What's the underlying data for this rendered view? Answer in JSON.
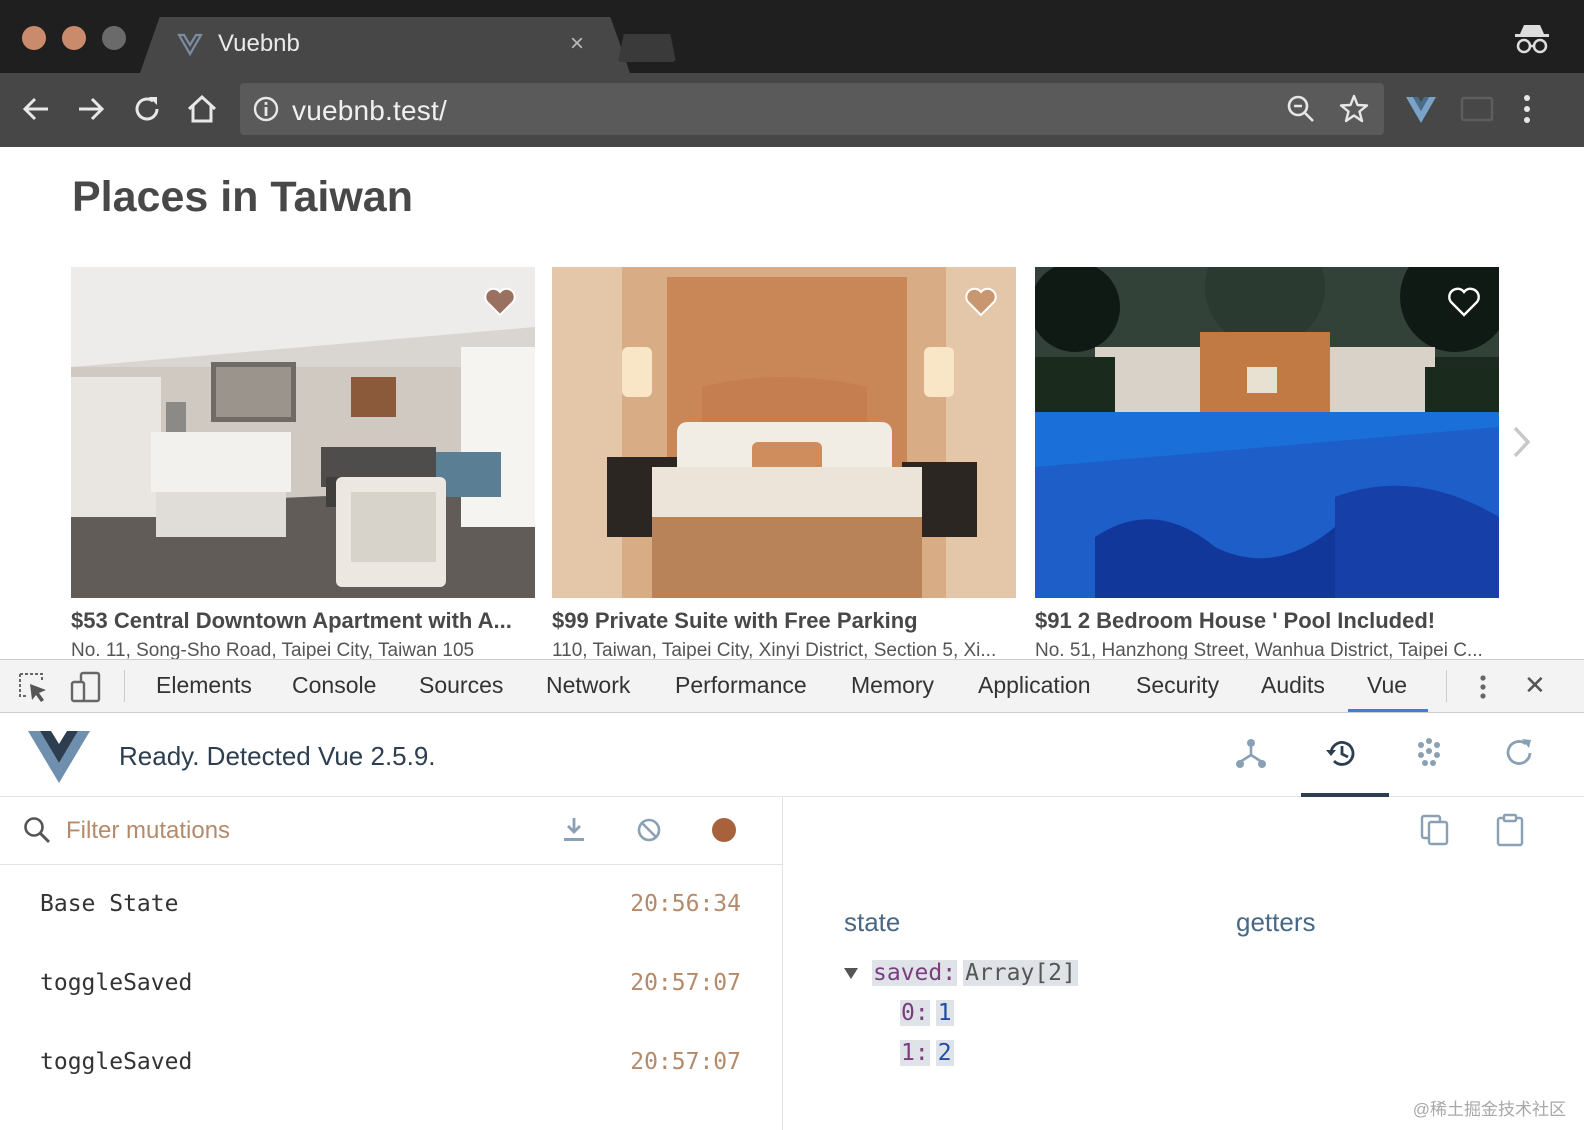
{
  "browser": {
    "tab_title": "Vuebnb",
    "tab_close": "×",
    "url": "vuebnb.test/",
    "colors": {
      "frame": "#1f1f1f",
      "toolbar": "#474747",
      "traffic_close": "#c98b6b",
      "traffic_min": "#c98b6b",
      "traffic_max": "#6a6a6a"
    },
    "icons": [
      "back-arrow-icon",
      "forward-arrow-icon",
      "reload-icon",
      "home-icon",
      "info-icon",
      "zoom-icon",
      "star-icon",
      "vue-extension-icon",
      "cast-icon",
      "more-vert-icon",
      "incognito-icon"
    ]
  },
  "page": {
    "heading": "Places in Taiwan",
    "listings": [
      {
        "title": "$53 Central Downtown Apartment with A...",
        "address": "No. 11, Song-Sho Road, Taipei City, Taiwan 105"
      },
      {
        "title": "$99 Private Suite with Free Parking",
        "address": "110, Taiwan, Taipei City, Xinyi District, Section 5, Xi..."
      },
      {
        "title": "$91 2 Bedroom House ' Pool Included!",
        "address": "No. 51, Hanzhong Street, Wanhua District, Taipei C..."
      }
    ]
  },
  "devtools": {
    "tabs": [
      "Elements",
      "Console",
      "Sources",
      "Network",
      "Performance",
      "Memory",
      "Application",
      "Security",
      "Audits",
      "Vue"
    ],
    "active_tab": "Vue",
    "close": "✕",
    "vue": {
      "status": "Ready. Detected Vue 2.5.9.",
      "filter_placeholder": "Filter mutations",
      "mutations": [
        {
          "name": "Base State",
          "time": "20:56:34"
        },
        {
          "name": "toggleSaved",
          "time": "20:57:07"
        },
        {
          "name": "toggleSaved",
          "time": "20:57:07"
        }
      ],
      "state_label": "state",
      "getters_label": "getters",
      "state_tree": {
        "key": "saved:",
        "type": "Array[2]",
        "items": [
          {
            "key": "0:",
            "value": "1"
          },
          {
            "key": "1:",
            "value": "2"
          }
        ]
      },
      "colors": {
        "accent": "#2c3e50",
        "time": "#b48a6a",
        "record": "#a8623b"
      }
    }
  },
  "watermark": "@稀土掘金技术社区"
}
